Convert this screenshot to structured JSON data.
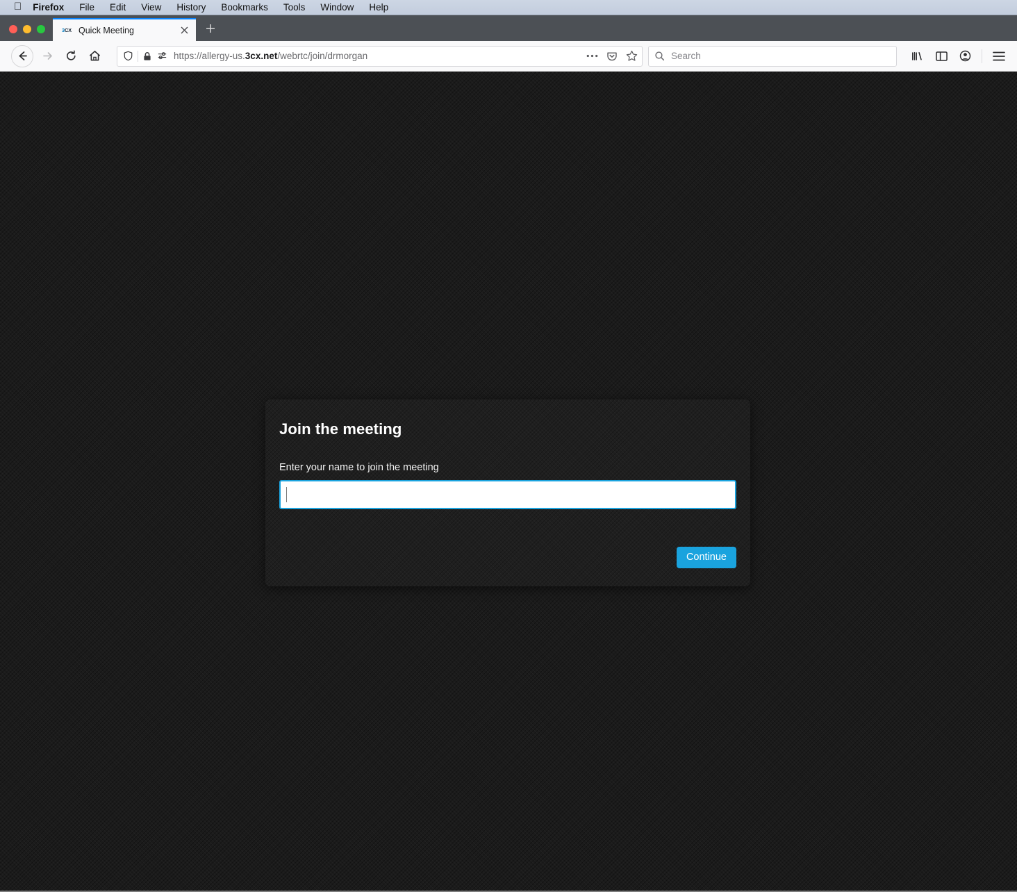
{
  "menubar": {
    "apple_icon": "apple-logo-icon",
    "items": [
      {
        "label": "Firefox",
        "bold": true
      },
      {
        "label": "File"
      },
      {
        "label": "Edit"
      },
      {
        "label": "View"
      },
      {
        "label": "History"
      },
      {
        "label": "Bookmarks"
      },
      {
        "label": "Tools"
      },
      {
        "label": "Window"
      },
      {
        "label": "Help"
      }
    ]
  },
  "window_controls": {
    "close_color": "#ff5f57",
    "minimize_color": "#febc2e",
    "maximize_color": "#28c840"
  },
  "tabs": {
    "active": {
      "title": "Quick Meeting",
      "favicon_text": "3CX",
      "favicon_accent": "#0a7fc2",
      "close_label": "×"
    },
    "new_tab_label": "+"
  },
  "toolbar": {
    "back_icon": "back-arrow-icon",
    "forward_icon": "forward-arrow-icon",
    "reload_icon": "reload-icon",
    "home_icon": "home-icon",
    "shield_icon": "tracking-protection-shield-icon",
    "lock_icon": "padlock-icon",
    "permissions_icon": "site-permissions-icon",
    "page_actions_icon": "page-actions-ellipsis-icon",
    "pocket_icon": "save-to-pocket-icon",
    "bookmark_icon": "bookmark-star-icon",
    "library_icon": "library-icon",
    "sidebar_icon": "sidebar-icon",
    "account_icon": "firefox-account-icon",
    "menu_icon": "hamburger-menu-icon"
  },
  "urlbar": {
    "scheme": "https://allergy-us.",
    "domain": "3cx.net",
    "path": "/webrtc/join/drmorgan"
  },
  "search": {
    "placeholder": "Search",
    "icon": "search-magnifier-icon"
  },
  "page": {
    "background_color": "#1b1b1b",
    "accent_color": "#1aa3de",
    "card": {
      "title": "Join the meeting",
      "field_label": "Enter your name to join the meeting",
      "name_value": "",
      "name_placeholder": "",
      "continue_label": "Continue"
    }
  }
}
